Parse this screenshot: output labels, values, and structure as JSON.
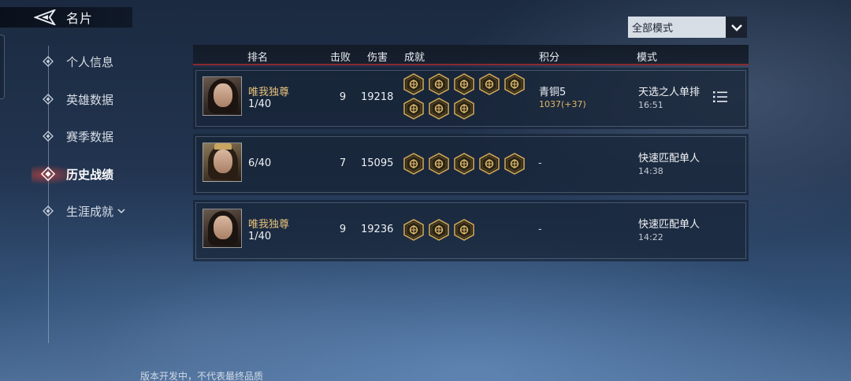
{
  "header": {
    "title": "名片"
  },
  "sidebar": {
    "items": [
      {
        "label": "个人信息"
      },
      {
        "label": "英雄数据"
      },
      {
        "label": "赛季数据"
      },
      {
        "label": "历史战绩"
      },
      {
        "label": "生涯成就"
      }
    ]
  },
  "mode_filter": {
    "value": "全部模式"
  },
  "table": {
    "columns": {
      "rank": "排名",
      "kills": "击败",
      "damage": "伤害",
      "achievements": "成就",
      "score": "积分",
      "mode": "模式"
    },
    "rows": [
      {
        "name": "唯我独尊",
        "rank": "1/40",
        "kills": "9",
        "damage": "19218",
        "tier": "青铜5",
        "points": "1037(+37)",
        "mode": "天选之人单排",
        "time": "16:51",
        "badge_count": 8
      },
      {
        "name": "",
        "rank": "6/40",
        "kills": "7",
        "damage": "15095",
        "score": "-",
        "mode": "快速匹配单人",
        "time": "14:38",
        "badge_count": 5
      },
      {
        "name": "唯我独尊",
        "rank": "1/40",
        "kills": "9",
        "damage": "19236",
        "score": "-",
        "mode": "快速匹配单人",
        "time": "14:22",
        "badge_count": 3
      }
    ]
  },
  "footer": {
    "note": "版本开发中，不代表最终品质"
  },
  "colors": {
    "accent_gold": "#e8c27a",
    "active_red": "#d8463c",
    "divider_red": "#8a2a30"
  }
}
